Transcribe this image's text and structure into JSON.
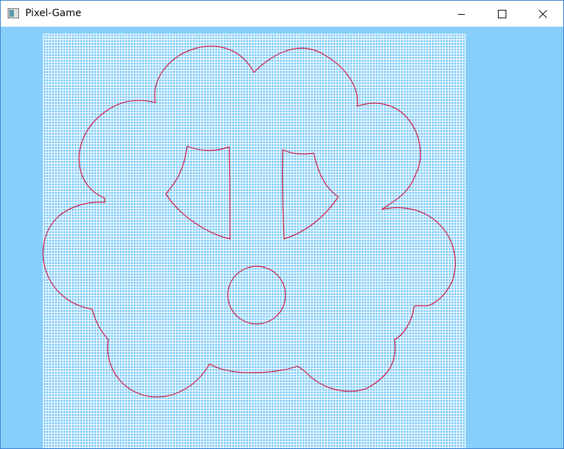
{
  "window": {
    "title": "Pixel-Game"
  },
  "icons": {
    "app": "app-window-icon",
    "minimize": "minimize-icon",
    "maximize": "maximize-icon",
    "close": "close-icon"
  },
  "colors": {
    "background": "#87CEFA",
    "grid_lines": "#FFFFFF",
    "outline": "#D0103A"
  }
}
